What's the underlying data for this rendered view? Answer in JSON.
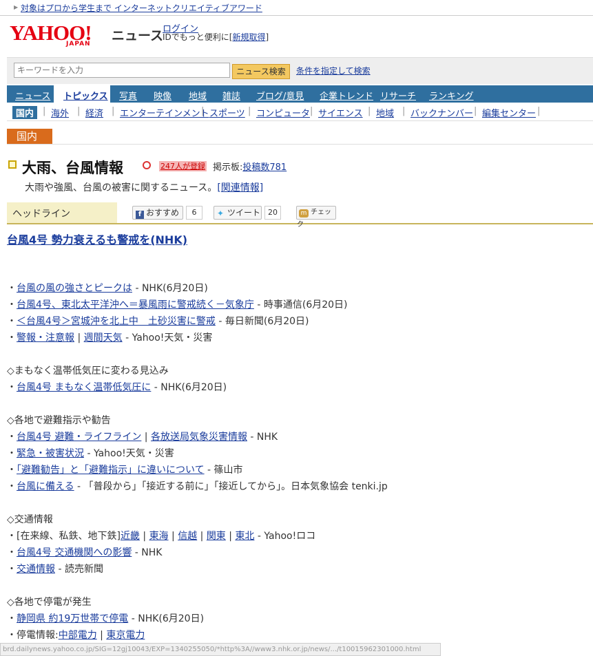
{
  "promo": {
    "text": "対象はプロから学生まで インターネットクリエイティブアワード"
  },
  "header": {
    "logo": "YAHOO!",
    "logo_sub": "JAPAN",
    "site": "ニュース",
    "login": "ログイン",
    "login_pre": "IDでもっと便利に[",
    "register": "新規取得",
    "login_post": "]"
  },
  "search": {
    "placeholder": "キーワードを入力",
    "button": "ニュース検索",
    "advanced": "条件を指定して検索"
  },
  "nav": {
    "tabs": [
      "ニュース",
      "トピックス",
      "写真",
      "映像",
      "地域",
      "雑誌",
      "ブログ/意見",
      "企業トレンド",
      "リサーチ",
      "ランキング"
    ],
    "active": "トピックス"
  },
  "subnav": {
    "current": "国内",
    "items": [
      "海外",
      "経済",
      "エンターテインメント",
      "スポーツ",
      "コンピュータ",
      "サイエンス",
      "地域",
      "バックナンバー",
      "編集センター"
    ]
  },
  "section": {
    "label": "国内"
  },
  "topic": {
    "title": "大雨、台風情報",
    "registered": "247人が登録",
    "bbs_label": "掲示板:",
    "bbs_link": "投稿数781",
    "description": "大雨や強風、台風の被害に関するニュース。",
    "related": "[関連情報]"
  },
  "headline_bar": {
    "label": "ヘッドライン",
    "fb_label": "おすすめ",
    "fb_count": "6",
    "tw_label": "ツイート",
    "tw_count": "20",
    "mixi_label": "チェック"
  },
  "main_headline": "台風4号 勢力衰えるも警戒を(NHK)",
  "items": {
    "i1": {
      "bullet": "・",
      "link": "台風の風の強さとピークは",
      "src": " - NHK(6月20日)"
    },
    "i2": {
      "bullet": "・",
      "link": "台風4号、東北太平洋沖へ＝暴風雨に警戒続く－気象庁",
      "src": " - 時事通信(6月20日)"
    },
    "i3": {
      "bullet": "・",
      "link": "＜台風4号＞宮城沖を北上中　土砂災害に警戒",
      "src": " - 毎日新聞(6月20日)"
    },
    "i4": {
      "bullet": "・",
      "link1": "警報・注意報",
      "sep": " | ",
      "link2": "週間天気",
      "src": " - Yahoo!天気・災害"
    },
    "h1": "◇まもなく温帯低気圧に変わる見込み",
    "i5": {
      "bullet": "・",
      "link": "台風4号 まもなく温帯低気圧に",
      "src": " - NHK(6月20日)"
    },
    "h2": "◇各地で避難指示や勧告",
    "i6": {
      "bullet": "・",
      "link1": "台風4号 避難・ライフライン",
      "sep": " | ",
      "link2": "各放送局気象災害情報",
      "src": " - NHK"
    },
    "i7": {
      "bullet": "・",
      "link": "緊急・被害状況",
      "src": " - Yahoo!天気・災害"
    },
    "i8": {
      "bullet": "・",
      "link": "「避難勧告」と「避難指示」に違いについて",
      "src": " - 篠山市"
    },
    "i9": {
      "bullet": "・",
      "link": "台風に備える",
      "src": " - 「普段から」「接近する前に」「接近してから」。日本気象協会 tenki.jp"
    },
    "h3": "◇交通情報",
    "i10": {
      "bullet": "・",
      "pre": "[在来線、私鉄、地下鉄]",
      "l1": "近畿",
      "l2": "東海",
      "l3": "信越",
      "l4": "関東",
      "l5": "東北",
      "sep": " | ",
      "src": " - Yahoo!ロコ"
    },
    "i11": {
      "bullet": "・",
      "link": "台風4号 交通機関への影響",
      "src": " - NHK"
    },
    "i12": {
      "bullet": "・",
      "link": "交通情報",
      "src": " - 読売新聞"
    },
    "h4": "◇各地で停電が発生",
    "i13": {
      "bullet": "・",
      "link": "静岡県 約19万世帯で停電",
      "src": " - NHK(6月20日)"
    },
    "i14": {
      "bullet": "・",
      "pre": "停電情報:",
      "link1": "中部電力",
      "sep": " | ",
      "link2": "東京電力"
    }
  },
  "status_bar": "brd.dailynews.yahoo.co.jp/SIG=12gj10043/EXP=1340255050/*http%3A//www3.nhk.or.jp/news/.../t10015962301000.html"
}
